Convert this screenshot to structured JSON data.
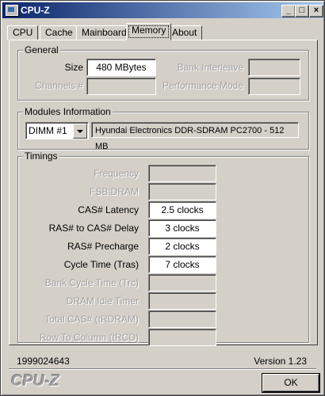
{
  "window": {
    "title": "CPU-Z"
  },
  "title_buttons": {
    "minimize": "_",
    "maximize": "□",
    "close": "×"
  },
  "tabs": [
    {
      "label": "CPU"
    },
    {
      "label": "Cache"
    },
    {
      "label": "Mainboard"
    },
    {
      "label": "Memory",
      "active": true
    },
    {
      "label": "About"
    }
  ],
  "general": {
    "title": "General",
    "size_label": "Size",
    "size_value": "480 MBytes",
    "channels_label": "Channels #",
    "channels_value": "",
    "bank_interleave_label": "Bank Interleave",
    "bank_interleave_value": "",
    "performance_mode_label": "Performance Mode",
    "performance_mode_value": ""
  },
  "modules": {
    "title": "Modules Information",
    "slot_selected": "DIMM #1",
    "description": "Hyundai Electronics DDR-SDRAM PC2700 - 512 MB"
  },
  "timings": {
    "title": "Timings",
    "rows": [
      {
        "label": "Frequency",
        "value": "",
        "enabled": false
      },
      {
        "label": "FSB:DRAM",
        "value": "",
        "enabled": false
      },
      {
        "label": "CAS# Latency",
        "value": "2.5 clocks",
        "enabled": true
      },
      {
        "label": "RAS# to CAS# Delay",
        "value": "3 clocks",
        "enabled": true
      },
      {
        "label": "RAS# Precharge",
        "value": "2 clocks",
        "enabled": true
      },
      {
        "label": "Cycle Time (Tras)",
        "value": "7 clocks",
        "enabled": true
      },
      {
        "label": "Bank Cycle Time (Trc)",
        "value": "",
        "enabled": false
      },
      {
        "label": "DRAM Idle Timer",
        "value": "",
        "enabled": false
      },
      {
        "label": "Total CAS# (tRDRAM)",
        "value": "",
        "enabled": false
      },
      {
        "label": "Row To Column (tRCD)",
        "value": "",
        "enabled": false
      }
    ]
  },
  "footer": {
    "id": "1999024643",
    "version": "Version 1.23",
    "logo": "CPU-Z",
    "ok_label": "OK"
  }
}
